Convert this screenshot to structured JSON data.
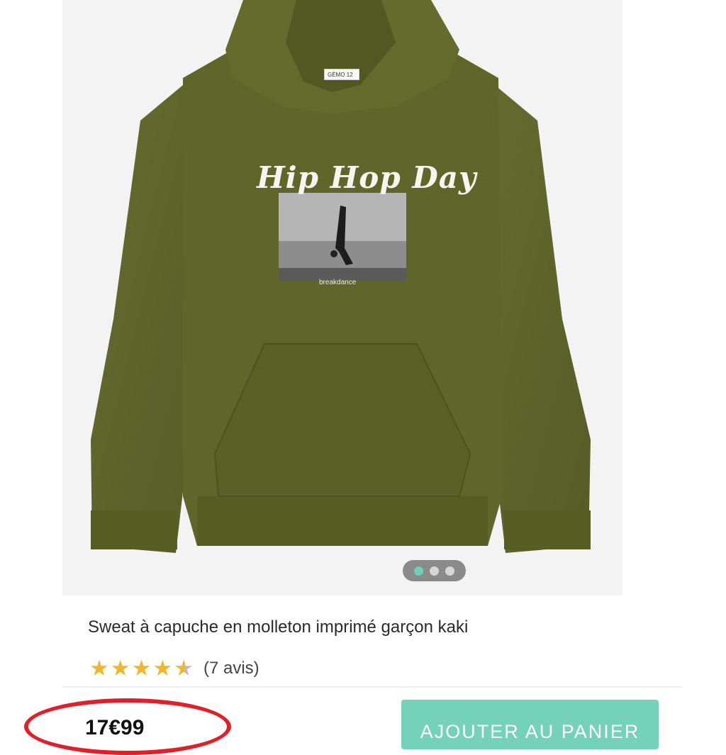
{
  "product": {
    "title": "Sweat à capuche en molleton imprimé garçon kaki",
    "image": {
      "print_title": "Hip Hop Day",
      "print_caption": "breakdance",
      "label_brand": "GÉMO",
      "label_size": "12"
    },
    "rating": {
      "value": 4.5,
      "max": 5,
      "reviews_label": "(7 avis)"
    },
    "price": "17€99",
    "add_to_cart_label": "AJOUTER AU PANIER"
  },
  "carousel": {
    "total": 3,
    "active_index": 0
  },
  "colors": {
    "accent": "#73d2b8",
    "star": "#f3b62a",
    "highlight_circle": "#e41e26",
    "hoodie": "#5d6429"
  }
}
